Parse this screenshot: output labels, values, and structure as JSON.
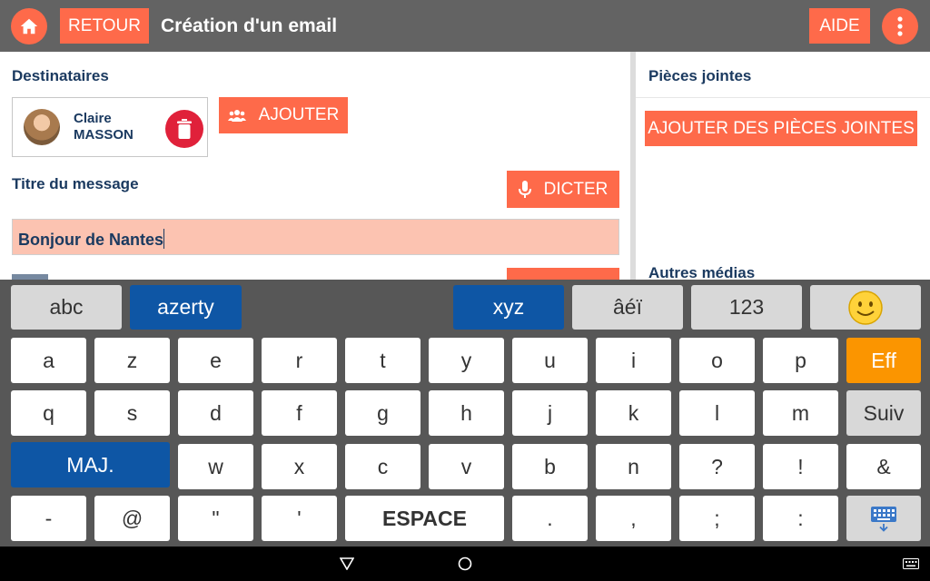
{
  "header": {
    "title": "Création d'un email",
    "back_label": "RETOUR",
    "help_label": "AIDE",
    "home_icon": "home-icon",
    "menu_icon": "more-vert-icon"
  },
  "recipients": {
    "label": "Destinataires",
    "list": [
      {
        "first_name": "Claire",
        "last_name": "MASSON"
      }
    ],
    "add_label": "AJOUTER"
  },
  "subject": {
    "label": "Titre du message",
    "dictate_label": "DICTER",
    "value": "Bonjour de Nantes"
  },
  "attachments": {
    "label": "Pièces jointes",
    "add_label": "AJOUTER DES PIÈCES JOINTES",
    "other_media_label": "Autres médias"
  },
  "keyboard": {
    "mode_keys": [
      "abc",
      "azerty",
      "xyz",
      "âéï",
      "123"
    ],
    "emoji_icon": "smiley-icon",
    "row1": [
      "a",
      "z",
      "e",
      "r",
      "t",
      "y",
      "u",
      "i",
      "o",
      "p"
    ],
    "delete_label": "Eff",
    "row2": [
      "q",
      "s",
      "d",
      "f",
      "g",
      "h",
      "j",
      "k",
      "l",
      "m"
    ],
    "next_label": "Suiv",
    "shift_label": "MAJ.",
    "row3": [
      "w",
      "x",
      "c",
      "v",
      "b",
      "n",
      "?",
      "!",
      "&"
    ],
    "row4_left": [
      "-",
      "@",
      "\"",
      "'"
    ],
    "space_label": "ESPACE",
    "row4_right": [
      ".",
      ",",
      ";",
      ":"
    ],
    "hide_icon": "keyboard-hide-icon"
  },
  "colors": {
    "accent": "#fe6a4a",
    "header": "#636363",
    "text_dark": "#1b3a60",
    "key_active": "#0e56a5",
    "key_delete": "#fb9500",
    "input_bg": "#fcc3b1",
    "danger": "#e0213a"
  }
}
